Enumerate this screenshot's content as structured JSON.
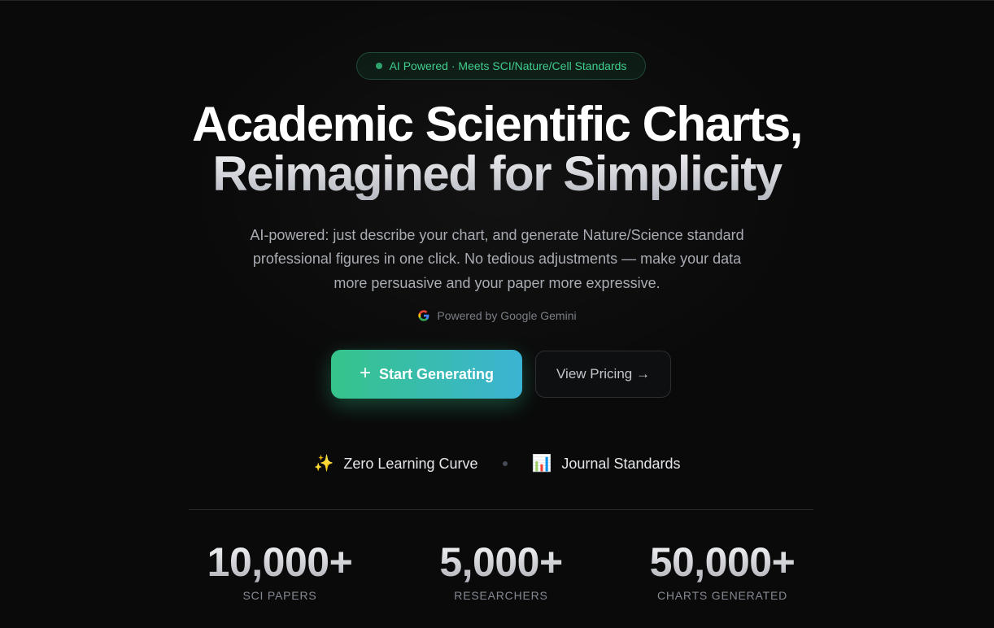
{
  "badge": {
    "text": "AI Powered · Meets SCI/Nature/Cell Standards"
  },
  "hero": {
    "title_line1": "Academic Scientific Charts,",
    "title_line2": "Reimagined for Simplicity",
    "subtitle_line1": "AI-powered: just describe your chart, and generate Nature/Science standard",
    "subtitle_line2": "professional figures in one click. No tedious adjustments — make your data",
    "subtitle_line3": "more persuasive and your paper more expressive.",
    "powered_by": "Powered by Google Gemini"
  },
  "cta": {
    "primary_label": "Start Generating",
    "primary_icon": "+",
    "secondary_label": "View Pricing →"
  },
  "features": [
    {
      "icon": "✨",
      "label": "Zero Learning Curve"
    },
    {
      "icon": "📊",
      "label": "Journal Standards"
    }
  ],
  "stats": [
    {
      "value": "10,000+",
      "label": "SCI PAPERS"
    },
    {
      "value": "5,000+",
      "label": "RESEARCHERS"
    },
    {
      "value": "50,000+",
      "label": "CHARTS GENERATED"
    }
  ],
  "colors": {
    "background": "#0a0a0a",
    "accent_green": "#36c48a",
    "accent_cyan": "#3bb3d3",
    "badge_text": "#3fcf8e"
  }
}
